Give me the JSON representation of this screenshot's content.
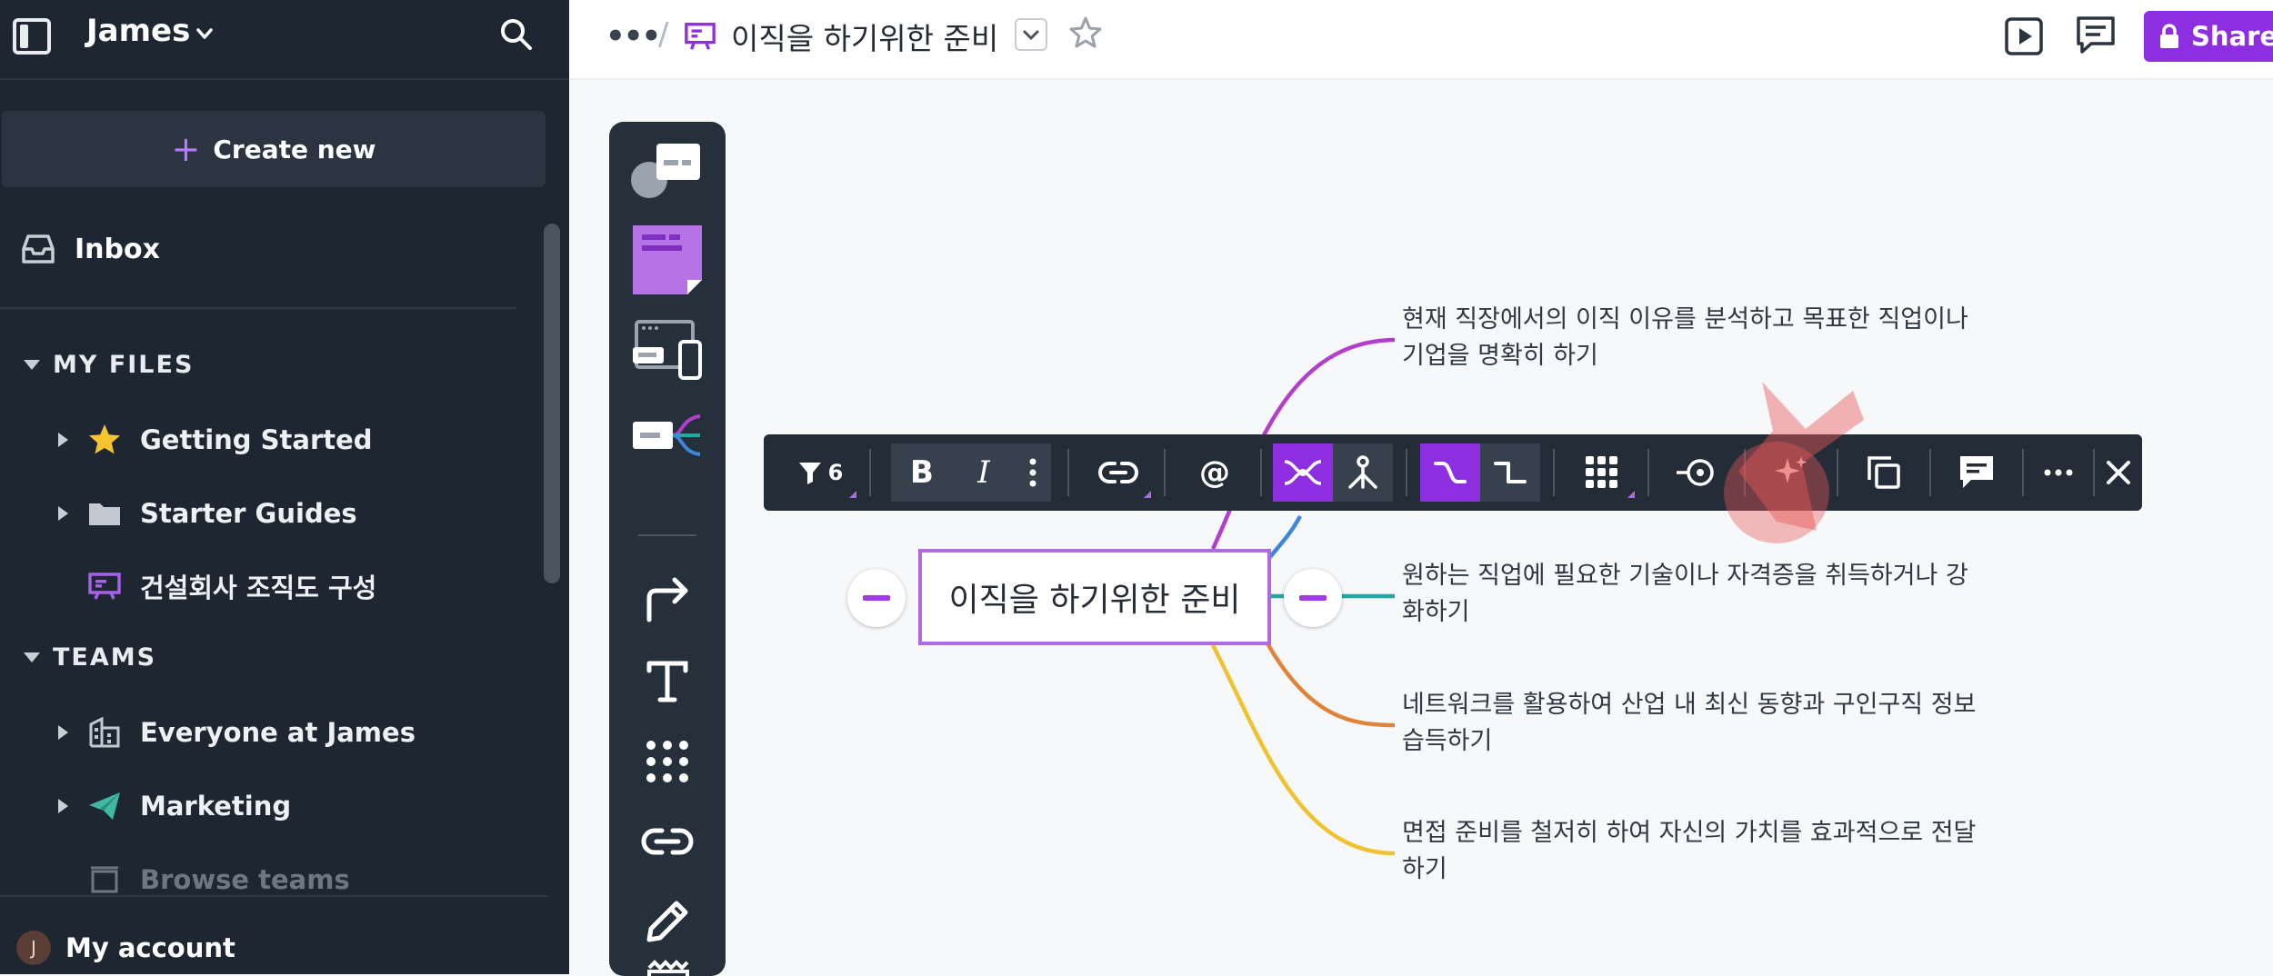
{
  "sidebar": {
    "user_name": "James",
    "create_new": "Create new",
    "inbox": "Inbox",
    "my_files_title": "MY FILES",
    "my_files": [
      {
        "label": "Getting Started",
        "icon": "star-icon"
      },
      {
        "label": "Starter Guides",
        "icon": "folder-icon"
      },
      {
        "label": "건설회사 조직도 구성",
        "icon": "board-icon"
      }
    ],
    "teams_title": "TEAMS",
    "teams": [
      {
        "label": "Everyone at James",
        "icon": "building-icon"
      },
      {
        "label": "Marketing",
        "icon": "paper-plane-icon"
      }
    ],
    "browse_teams": "Browse teams",
    "account_initial": "J",
    "account_label": "My account"
  },
  "header": {
    "more": "•••",
    "separator": "/",
    "board_title": "이직을 하기위한 준비",
    "share_label": "Share"
  },
  "canvas": {
    "central_topic": "이직을 하기위한 준비",
    "branches": [
      {
        "text": "현재 직장에서의 이직 이유를 분석하고 목표한 직업이나 기업을 명확히 하기",
        "color": "#b23fcc"
      },
      {
        "text": "원하는 직업에 필요한 기술이나 자격증을 취득하거나 강화하기",
        "color": "#22a6a6"
      },
      {
        "text": "네트워크를 활용하여 산업 내 최신 동향과 구인구직 정보 습득하기",
        "color": "#e0843a"
      },
      {
        "text": "면접 준비를 철저히 하여 자신의 가치를 효과적으로 전달하기",
        "color": "#efc231"
      }
    ],
    "hidden_branch_color": "#3f86d8"
  },
  "toolbar": {
    "filter_count": "6",
    "bold": "B",
    "italic": "I",
    "mention": "@"
  },
  "colors": {
    "accent": "#8d2fe0",
    "sidebar_bg": "#1e2731",
    "toolbar_bg": "#232c37"
  }
}
